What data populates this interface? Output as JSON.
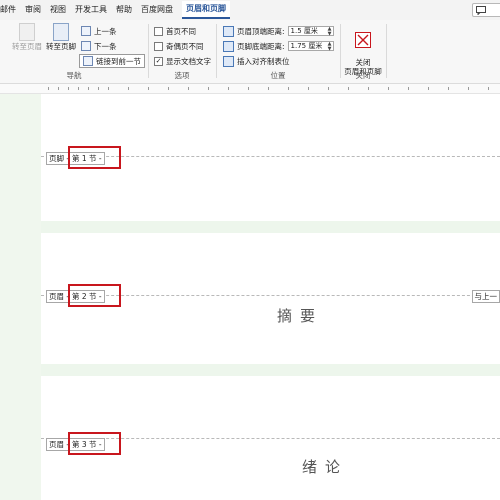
{
  "menu": {
    "items": [
      "邮件",
      "审阅",
      "视图",
      "开发工具",
      "帮助",
      "百度网盘",
      "页眉和页脚"
    ],
    "share_icon": "comment-icon"
  },
  "ribbon": {
    "nav": {
      "goto_header": "转至页眉",
      "goto_footer": "转至页脚",
      "previous": "上一条",
      "next": "下一条",
      "link_previous": "链接到前一节",
      "label": "导航"
    },
    "options": {
      "first_page": "首页不同",
      "odd_even": "奇偶页不同",
      "show_text": "显示文档文字",
      "show_text_checked": "✓",
      "label": "选项"
    },
    "position": {
      "header_top": "页眉顶端距离:",
      "header_top_value": "1.5 厘米",
      "footer_bottom": "页脚底端距离:",
      "footer_bottom_value": "1.75 厘米",
      "insert_align_tab": "插入对齐制表位",
      "label": "位置"
    },
    "close": {
      "button": "关闭\n页眉和页脚",
      "label": "关闭",
      "close_icon_color": "#c8161d"
    }
  },
  "document": {
    "sections": [
      {
        "region": "页脚 -",
        "section": "第 1 节 -"
      },
      {
        "region": "页眉 -",
        "section": "第 2 节 -",
        "same_as_previous": "与上一",
        "title": "摘要"
      },
      {
        "region": "页眉 -",
        "section": "第 3 节 -",
        "title": "绪论"
      }
    ],
    "highlight_color": "#c8161d",
    "gap_color": "#edf6ec"
  }
}
